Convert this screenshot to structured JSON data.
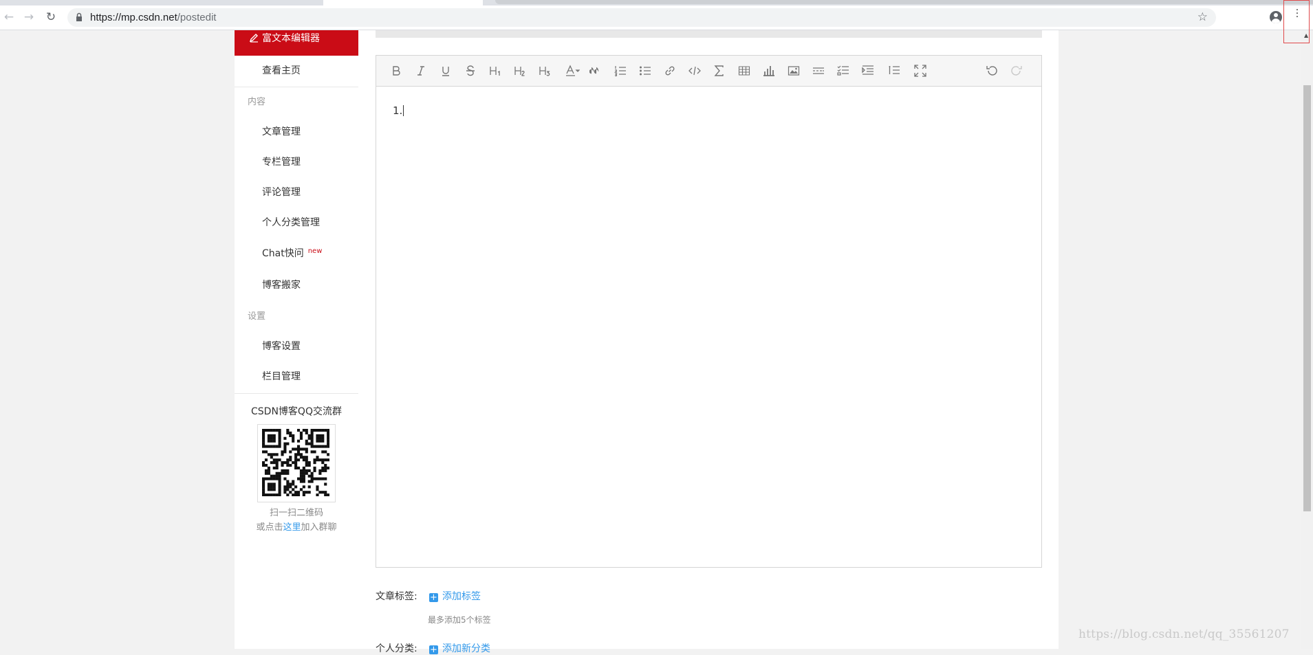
{
  "browser": {
    "url_host": "https://mp.csdn.net",
    "url_path": "/postedit"
  },
  "sidebar": {
    "active_item": "富文本编辑器",
    "items_top": [
      {
        "label": "查看主页"
      }
    ],
    "content_group": "内容",
    "content_items": [
      {
        "label": "文章管理"
      },
      {
        "label": "专栏管理"
      },
      {
        "label": "评论管理"
      },
      {
        "label": "个人分类管理"
      },
      {
        "label": "Chat快问",
        "badge": "new"
      },
      {
        "label": "博客搬家"
      }
    ],
    "settings_group": "设置",
    "settings_items": [
      {
        "label": "博客设置"
      },
      {
        "label": "栏目管理"
      }
    ],
    "qq_group_title": "CSDN博客QQ交流群",
    "qr_tip_line1": "扫一扫二维码",
    "qr_tip_pre": "或点击",
    "qr_tip_link": "这里",
    "qr_tip_post": "加入群聊"
  },
  "editor": {
    "toolbar_icons": [
      "bold-icon",
      "italic-icon",
      "underline-icon",
      "strikethrough-icon",
      "heading1-icon",
      "heading2-icon",
      "heading3-icon",
      "font-color-icon",
      "quote-icon",
      "ordered-list-icon",
      "unordered-list-icon",
      "link-icon",
      "code-icon",
      "formula-icon",
      "table-icon",
      "chart-icon",
      "image-icon",
      "horizontal-rule-icon",
      "todo-list-icon",
      "indent-icon",
      "line-number-icon",
      "fullscreen-icon",
      "undo-icon",
      "redo-icon"
    ],
    "content": "1."
  },
  "form": {
    "tags_label": "文章标签:",
    "add_tag": "添加标签",
    "tags_hint": "最多添加5个标签",
    "category_label": "个人分类:",
    "add_category": "添加新分类"
  },
  "watermark": "https://blog.csdn.net/qq_35561207",
  "colors": {
    "accent_red": "#ca0c16",
    "link_blue": "#3399ea",
    "page_bg": "#f2f2f2"
  }
}
